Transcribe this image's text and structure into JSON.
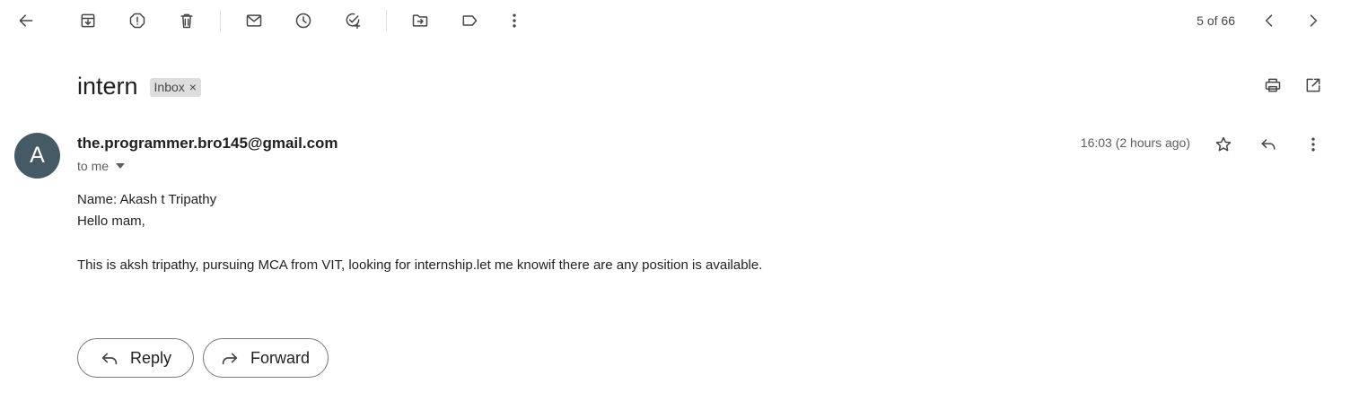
{
  "toolbar": {
    "icons": [
      "back-arrow-icon",
      "archive-icon",
      "report-spam-icon",
      "delete-icon",
      "mark-unread-icon",
      "snooze-icon",
      "add-to-tasks-icon",
      "move-to-icon",
      "label-icon",
      "more-options-icon"
    ],
    "pager": {
      "count": "5 of 66"
    }
  },
  "message": {
    "subject": "intern",
    "label": "Inbox",
    "label_close": "×",
    "avatar_letter": "A",
    "sender": "the.programmer.bro145@gmail.com",
    "recipient": "to me",
    "timestamp": "16:03 (2 hours ago)",
    "body": {
      "line1": "Name: Akash t Tripathy",
      "line2": "Hello mam,",
      "line3": "This is aksh tripathy, pursuing MCA from VIT, looking for internship.let me knowif there are any position is available."
    }
  },
  "actions": {
    "reply_label": "Reply",
    "forward_label": "Forward"
  },
  "colors": {
    "avatar_bg": "#455a64",
    "label_chip_bg": "#dddddd",
    "icon_color": "#444746"
  }
}
